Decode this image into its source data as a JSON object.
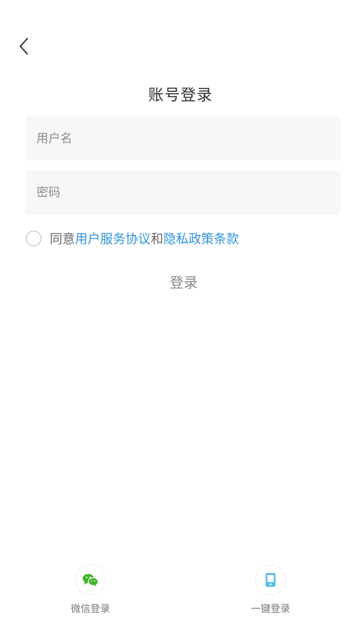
{
  "header": {
    "title": "账号登录"
  },
  "form": {
    "username_placeholder": "用户名",
    "password_placeholder": "密码"
  },
  "agreement": {
    "prefix": "同意",
    "service_link": "用户服务协议",
    "conjunction": "和",
    "privacy_link": "隐私政策条款"
  },
  "login_button": "登录",
  "alt_logins": {
    "wechat_label": "微信登录",
    "onekey_label": "一键登录"
  },
  "colors": {
    "link": "#2e93d6",
    "wechat": "#3fb32a",
    "phone": "#5bc0e8",
    "field_bg": "#f7f7f7"
  },
  "icons": {
    "back": "chevron-left-icon",
    "wechat": "wechat-icon",
    "onekey": "phone-icon"
  }
}
